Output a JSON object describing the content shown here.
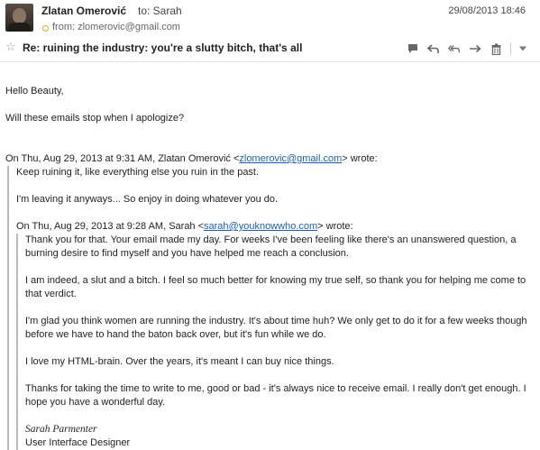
{
  "header": {
    "sender_name": "Zlatan Omerović",
    "to_text": "to: Sarah",
    "date": "29/08/2013 18:46",
    "from_text": "from: zlomerovic@gmail.com",
    "subject": "Re: ruining the industry: you're a slutty bitch, that's all",
    "accent_dot_color": "#e8a71c"
  },
  "toolbar": {
    "icons": [
      "chat-icon",
      "reply-icon",
      "reply-all-icon",
      "forward-icon",
      "trash-icon",
      "more-dropdown-icon"
    ]
  },
  "message": {
    "greeting": "Hello Beauty,",
    "line1": "Will these emails stop when I apologize?",
    "quote_header_1_prefix": "On Thu, Aug 29, 2013 at 9:31 AM, Zlatan Omerović <",
    "quote_header_1_email": "zlomerovic@gmail.com",
    "quote_header_1_suffix": "> wrote:",
    "quote1_line1": "Keep ruining it, like everything else you ruin in the past.",
    "quote1_line2": "I'm leaving it anyways... So enjoy in doing whatever you do.",
    "quote_header_2_prefix": "On Thu, Aug 29, 2013 at 9:28 AM, Sarah <",
    "quote_header_2_email": "sarah@youknowwho.com",
    "quote_header_2_suffix": "> wrote:",
    "quote2_paragraphs": [
      "Thank you for that. Your email made my day. For weeks I've been feeling like there's an unanswered question, a burning desire to find myself and you have helped me reach a conclusion.",
      "I am indeed, a slut and a bitch. I feel so much better for knowing my true self, so thank you for helping me come to that verdict.",
      "I'm glad you think women are running the industry. It's about time huh? We only get to do it for a few weeks though before we have to hand the baton back over, but it's fun while we do.",
      "I love my HTML-brain. Over the years, it's meant I can buy nice things.",
      "Thanks for taking the time to write to me, good or bad - it's always nice to receive email. I really don't get enough. I hope you have a wonderful day."
    ],
    "signature_name": "Sarah Parmenter",
    "signature_title": "User Interface Designer"
  }
}
